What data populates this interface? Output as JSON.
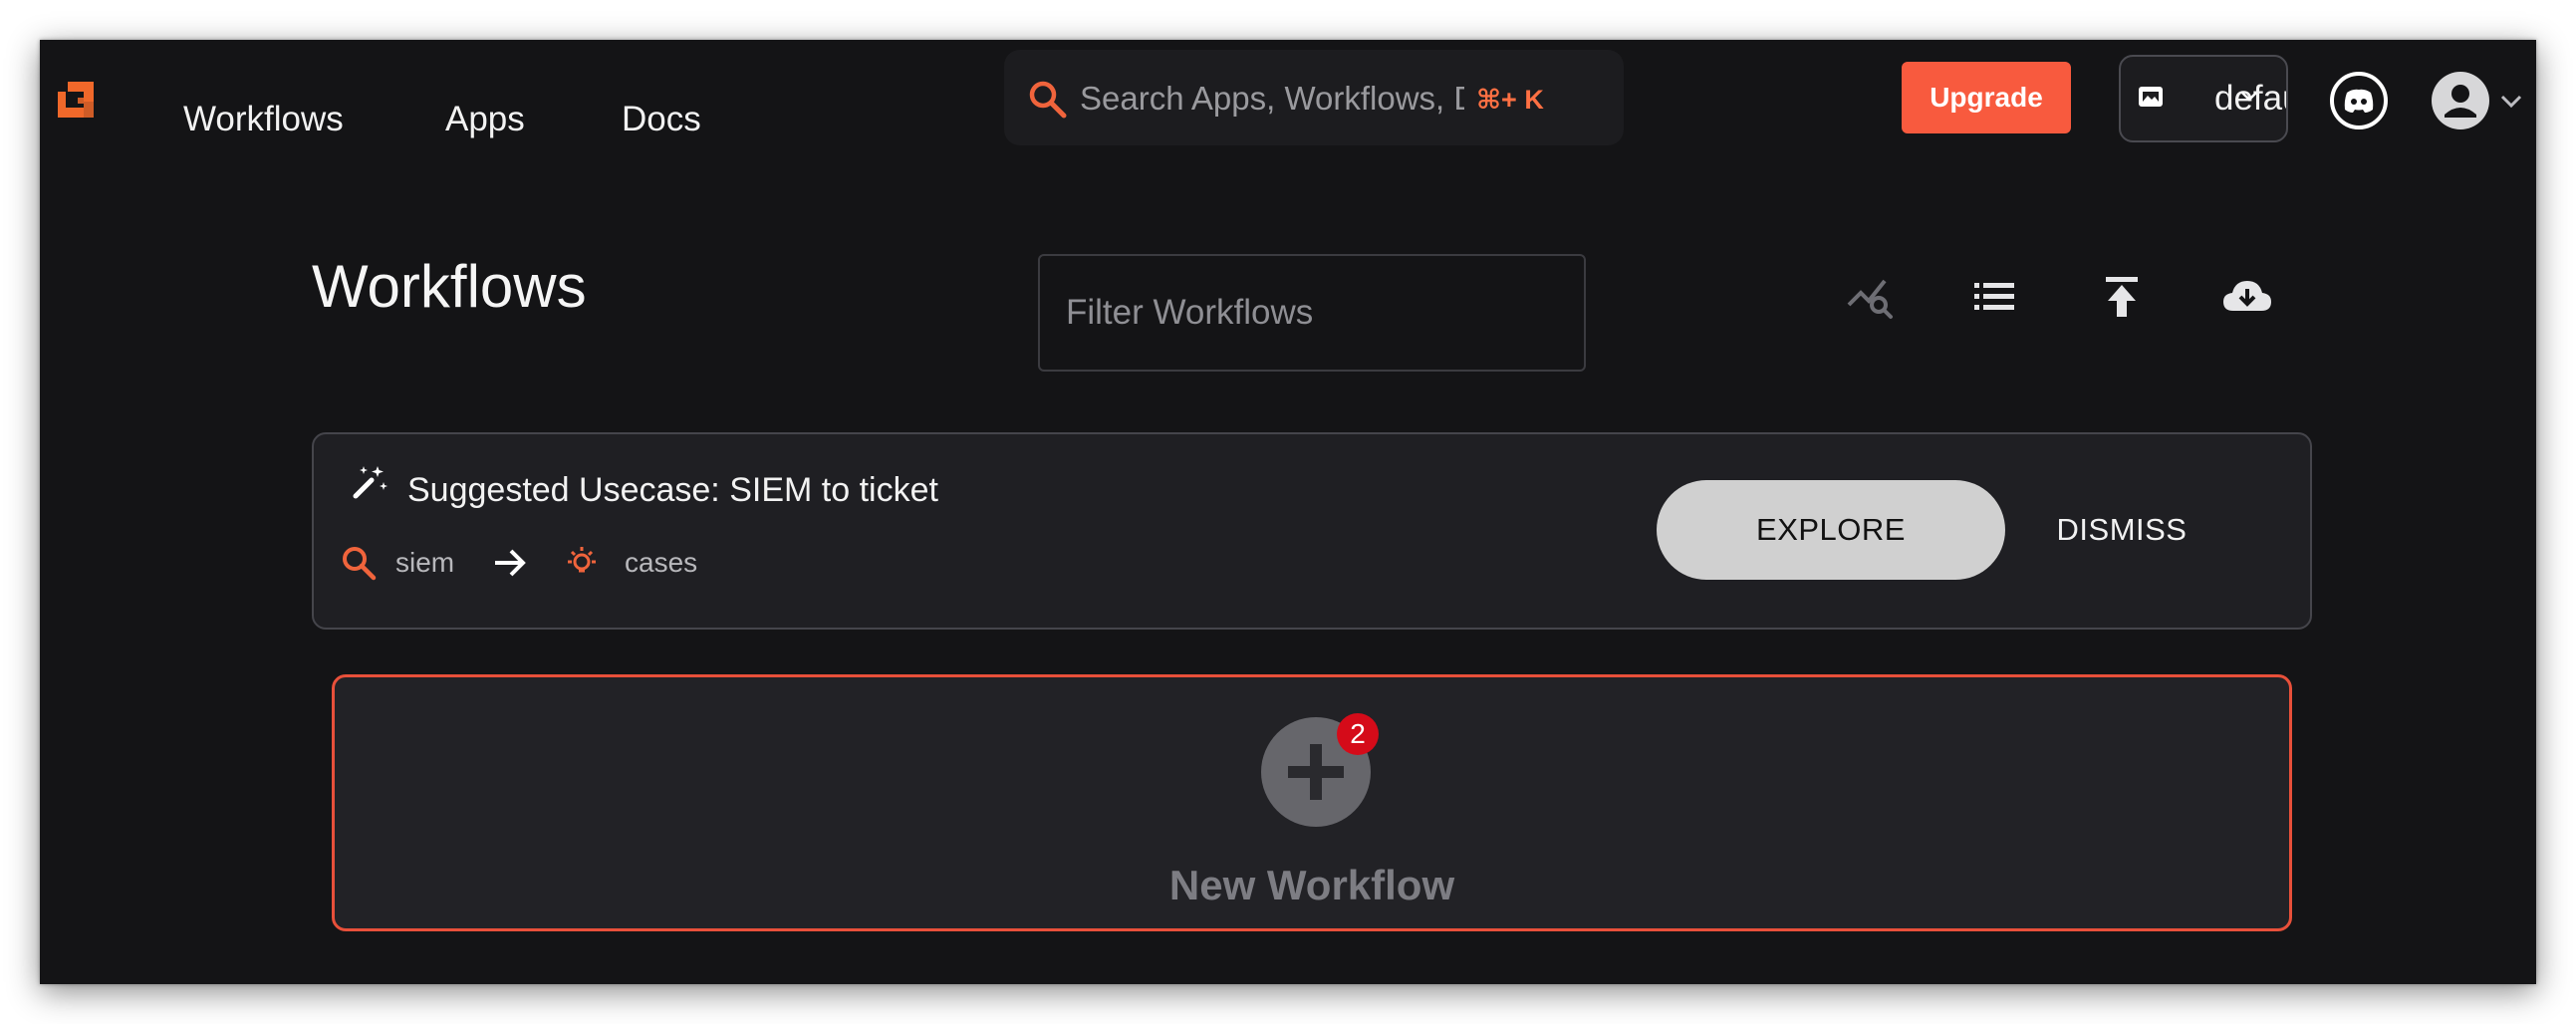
{
  "nav": {
    "links": [
      "Workflows",
      "Apps",
      "Docs"
    ],
    "search_placeholder": "Search Apps, Workflows, Docs",
    "search_shortcut": "⌘+ K",
    "upgrade_label": "Upgrade",
    "org_name": "default"
  },
  "page": {
    "title": "Workflows",
    "filter_placeholder": "Filter Workflows",
    "tools": [
      "analytics-search-icon",
      "list-view-icon",
      "upload-icon",
      "cloud-download-icon"
    ]
  },
  "suggestion": {
    "title": "Suggested Usecase: SIEM to ticket",
    "from_label": "siem",
    "to_label": "cases",
    "explore_label": "EXPLORE",
    "dismiss_label": "DISMISS"
  },
  "new_workflow": {
    "label": "New Workflow",
    "badge_count": "2"
  },
  "colors": {
    "background": "#141416",
    "accent": "#f85a3e",
    "card": "#1f1f23",
    "badge": "#d50b19"
  }
}
